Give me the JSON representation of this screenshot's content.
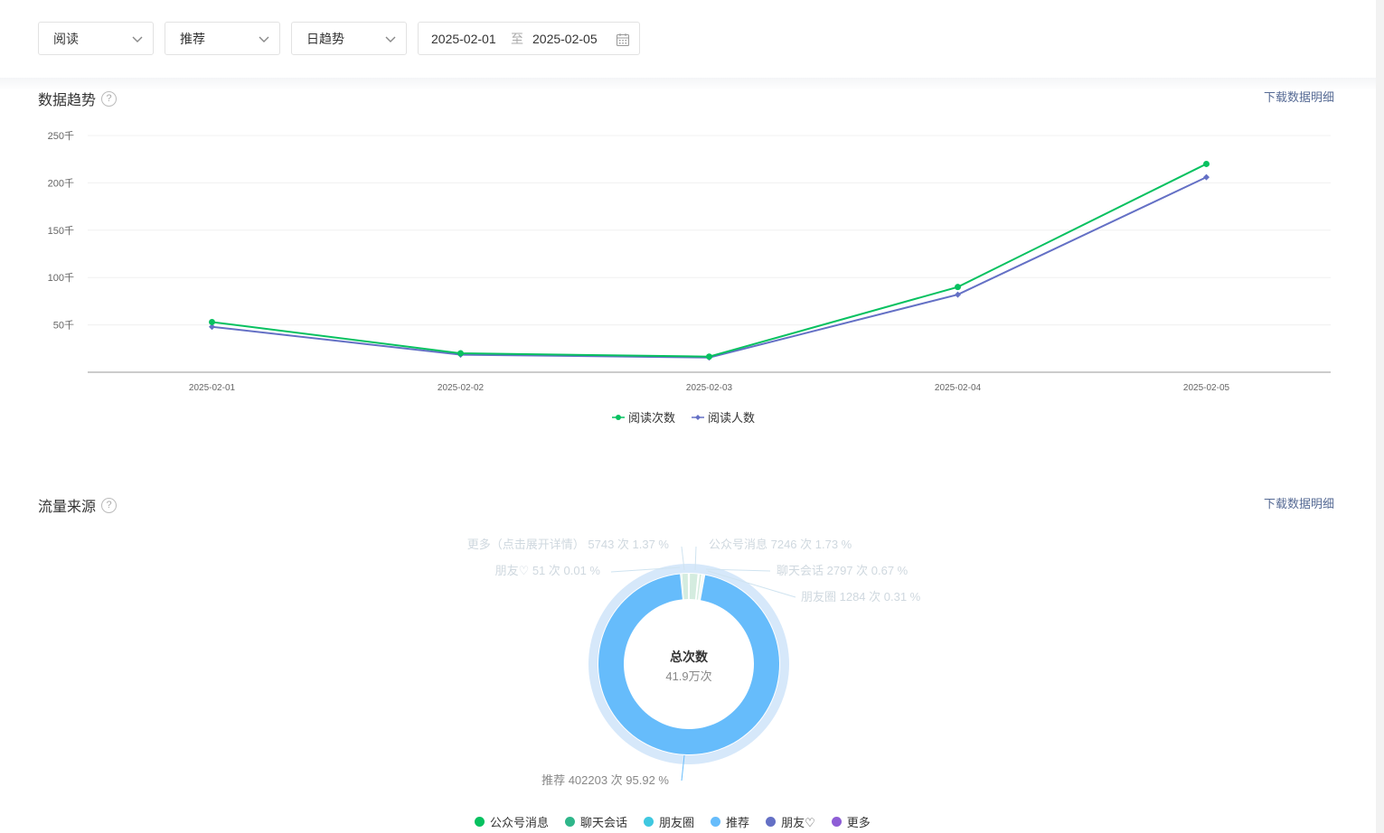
{
  "filters": {
    "metric": "阅读",
    "source": "推荐",
    "granularity": "日趋势",
    "date_start": "2025-02-01",
    "date_sep": "至",
    "date_end": "2025-02-05"
  },
  "trend": {
    "title": "数据趋势",
    "download_label": "下载数据明细",
    "help_label": "?"
  },
  "traffic": {
    "title": "流量来源",
    "download_label": "下载数据明细",
    "help_label": "?",
    "center_title": "总次数",
    "center_value": "41.9万次"
  },
  "colors": {
    "green": "#07c160",
    "purple": "#6470c5",
    "blue": "#66bcfb",
    "teal": "#2fb68a",
    "cyan": "#3fc8e0",
    "violet": "#8e5ed6",
    "link": "#576b95"
  },
  "chart_data": [
    {
      "type": "line",
      "x": [
        "2025-02-01",
        "2025-02-02",
        "2025-02-03",
        "2025-02-04",
        "2025-02-05"
      ],
      "y_tick_labels": [
        "50千",
        "100千",
        "150千",
        "200千",
        "250千"
      ],
      "ylim": [
        0,
        250000
      ],
      "grid": true,
      "legend_position": "bottom",
      "series": [
        {
          "name": "阅读次数",
          "color": "#07c160",
          "marker": "circle",
          "values": [
            53000,
            20000,
            16500,
            90000,
            220000
          ]
        },
        {
          "name": "阅读人数",
          "color": "#6470c5",
          "marker": "diamond",
          "values": [
            48000,
            18500,
            15500,
            82000,
            206000
          ]
        }
      ]
    },
    {
      "type": "pie",
      "donut": true,
      "legend_position": "bottom",
      "slices": [
        {
          "name": "公众号消息",
          "count": 7246,
          "percent": 1.73,
          "label": "公众号消息 7246 次 1.73 %",
          "color": "#07c160"
        },
        {
          "name": "聊天会话",
          "count": 2797,
          "percent": 0.67,
          "label": "聊天会话 2797 次 0.67 %",
          "color": "#2fb68a"
        },
        {
          "name": "朋友圈",
          "count": 1284,
          "percent": 0.31,
          "label": "朋友圈 1284 次 0.31 %",
          "color": "#3fc8e0"
        },
        {
          "name": "推荐",
          "count": 402203,
          "percent": 95.92,
          "label": "推荐 402203 次 95.92 %",
          "color": "#66bcfb"
        },
        {
          "name": "朋友♡",
          "count": 51,
          "percent": 0.01,
          "label": "朋友♡ 51 次 0.01 %",
          "color": "#6470c5"
        },
        {
          "name": "更多",
          "count": 5743,
          "percent": 1.37,
          "label": "更多（点击展开详情） 5743 次 1.37 %",
          "color": "#8e5ed6"
        }
      ]
    }
  ]
}
